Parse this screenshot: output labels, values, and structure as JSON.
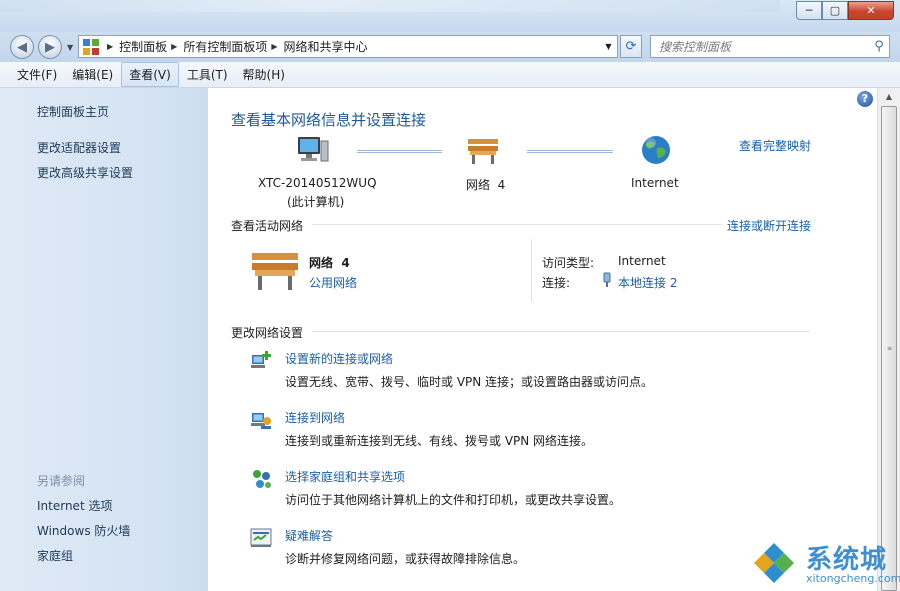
{
  "window": {
    "minimize": "─",
    "maximize": "▢",
    "close": "✕"
  },
  "nav": {
    "back": "◀",
    "forward": "▶",
    "breadcrumb": [
      "控制面板",
      "所有控制面板项",
      "网络和共享中心"
    ],
    "search_placeholder": "搜索控制面板"
  },
  "menu": [
    "文件(F)",
    "编辑(E)",
    "查看(V)",
    "工具(T)",
    "帮助(H)"
  ],
  "sidebar": {
    "home": "控制面板主页",
    "items": [
      "更改适配器设置",
      "更改高级共享设置"
    ],
    "see_also_header": "另请参阅",
    "see_also": [
      "Internet 选项",
      "Windows 防火墙",
      "家庭组"
    ]
  },
  "main": {
    "title": "查看基本网络信息并设置连接",
    "full_map_link": "查看完整映射",
    "map": {
      "computer_name": "XTC-20140512WUQ",
      "computer_sub": "(此计算机)",
      "network_name": "网络  4",
      "internet": "Internet"
    },
    "active": {
      "header": "查看活动网络",
      "connect_link": "连接或断开连接",
      "network_name": "网络  4",
      "network_type": "公用网络",
      "access_label": "访问类型:",
      "access_value": "Internet",
      "conn_label": "连接:",
      "conn_value": "本地连接 2"
    },
    "change": {
      "header": "更改网络设置",
      "tasks": [
        {
          "title": "设置新的连接或网络",
          "desc": "设置无线、宽带、拨号、临时或 VPN 连接；或设置路由器或访问点。"
        },
        {
          "title": "连接到网络",
          "desc": "连接到或重新连接到无线、有线、拨号或 VPN 网络连接。"
        },
        {
          "title": "选择家庭组和共享选项",
          "desc": "访问位于其他网络计算机上的文件和打印机，或更改共享设置。"
        },
        {
          "title": "疑难解答",
          "desc": "诊断并修复网络问题，或获得故障排除信息。"
        }
      ]
    }
  },
  "help": "?",
  "watermark": {
    "cn": "系统城",
    "en": "xitongcheng.com"
  }
}
